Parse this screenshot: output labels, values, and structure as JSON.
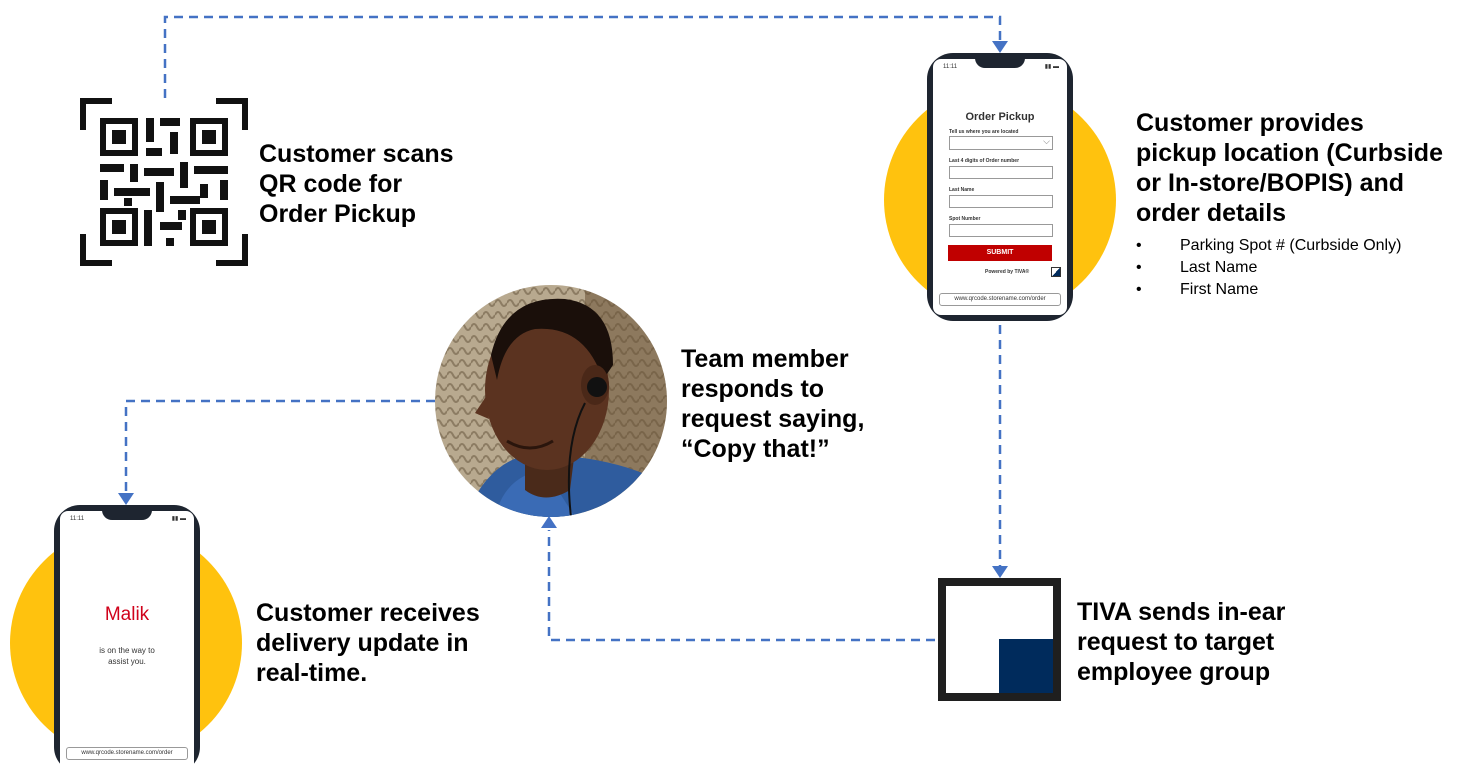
{
  "colors": {
    "accent_circle": "#FFC20E",
    "connector": "#4472C4",
    "tiva_square": "#002B5C",
    "submit": "#C00000",
    "agent_name": "#D0021B"
  },
  "steps": {
    "scan": {
      "lines": [
        "Customer scans",
        "QR code for",
        "Order Pickup"
      ]
    },
    "provide": {
      "lines": [
        "Customer provides",
        "pickup location (Curbside",
        "or In-store/BOPIS) and",
        "order details"
      ],
      "bullets": [
        "Parking Spot # (Curbside Only)",
        "Last Name",
        "First Name"
      ]
    },
    "team": {
      "lines": [
        "Team member",
        "responds to",
        "request saying,",
        "“Copy that!”"
      ]
    },
    "tiva": {
      "lines": [
        "TIVA sends in-ear",
        "request to target",
        "employee group"
      ]
    },
    "receive": {
      "lines": [
        "Customer receives",
        "delivery update in",
        "real-time."
      ]
    }
  },
  "phone_form": {
    "status_time": "11:11",
    "title": "Order Pickup",
    "field1_label": "Tell us where you are located",
    "field2_label": "Last 4 digits of Order number",
    "field3_label": "Last Name",
    "field4_label": "Spot Number",
    "submit_label": "SUBMIT",
    "powered_by": "Powered by  TIVA®",
    "url": "www.qrcode.storename.com/order"
  },
  "phone_update": {
    "status_time": "11:11",
    "name": "Malik",
    "message_line1": "is on the way to",
    "message_line2": "assist you.",
    "url": "www.qrcode.storename.com/order"
  }
}
